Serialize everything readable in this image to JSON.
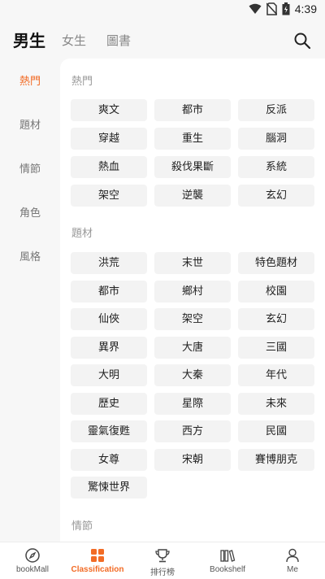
{
  "status_bar": {
    "time": "4:39"
  },
  "header": {
    "tab_male": "男生",
    "tab_female": "女生",
    "tab_books": "圖書"
  },
  "sidebar": {
    "items": [
      "熱門",
      "題材",
      "情節",
      "角色",
      "風格"
    ],
    "active_index": 0
  },
  "sections": [
    {
      "title": "熱門",
      "tags": [
        "爽文",
        "都市",
        "反派",
        "穿越",
        "重生",
        "腦洞",
        "熱血",
        "殺伐果斷",
        "系統",
        "架空",
        "逆襲",
        "玄幻"
      ]
    },
    {
      "title": "題材",
      "tags": [
        "洪荒",
        "末世",
        "特色題材",
        "都市",
        "鄉村",
        "校園",
        "仙俠",
        "架空",
        "玄幻",
        "異界",
        "大唐",
        "三國",
        "大明",
        "大秦",
        "年代",
        "歷史",
        "星際",
        "未來",
        "靈氣復甦",
        "西方",
        "民國",
        "女尊",
        "宋朝",
        "賽博朋克",
        "驚悚世界"
      ]
    },
    {
      "title": "情節",
      "tags": []
    }
  ],
  "bottom_nav": {
    "items": [
      {
        "label": "bookMall",
        "icon": "compass-icon"
      },
      {
        "label": "Classification",
        "icon": "grid-icon"
      },
      {
        "label": "排行榜",
        "icon": "trophy-icon"
      },
      {
        "label": "Bookshelf",
        "icon": "bookshelf-icon"
      },
      {
        "label": "Me",
        "icon": "person-icon"
      }
    ],
    "active_index": 1
  },
  "colors": {
    "accent": "#f26b25",
    "tag_bg": "#f3f3f3",
    "page_bg": "#f7f7f7"
  }
}
